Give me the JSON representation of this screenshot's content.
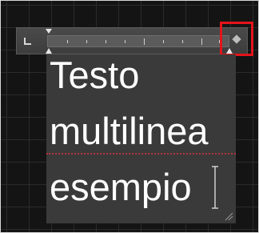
{
  "text_frame": {
    "lines": [
      "Testo",
      "multilinea",
      "esempio"
    ]
  },
  "colors": {
    "background": "#141414",
    "grid": "#2b2b2b",
    "frame": "#3a3a3a",
    "text": "#ffffff",
    "highlight": "#e4141a",
    "baseline": "#b3343a"
  },
  "icons": {
    "tab_stop": "tab-stop-corner-icon",
    "right_control": "diamond-icon",
    "caret": "i-beam-cursor-icon",
    "resize": "resize-grip-icon"
  }
}
